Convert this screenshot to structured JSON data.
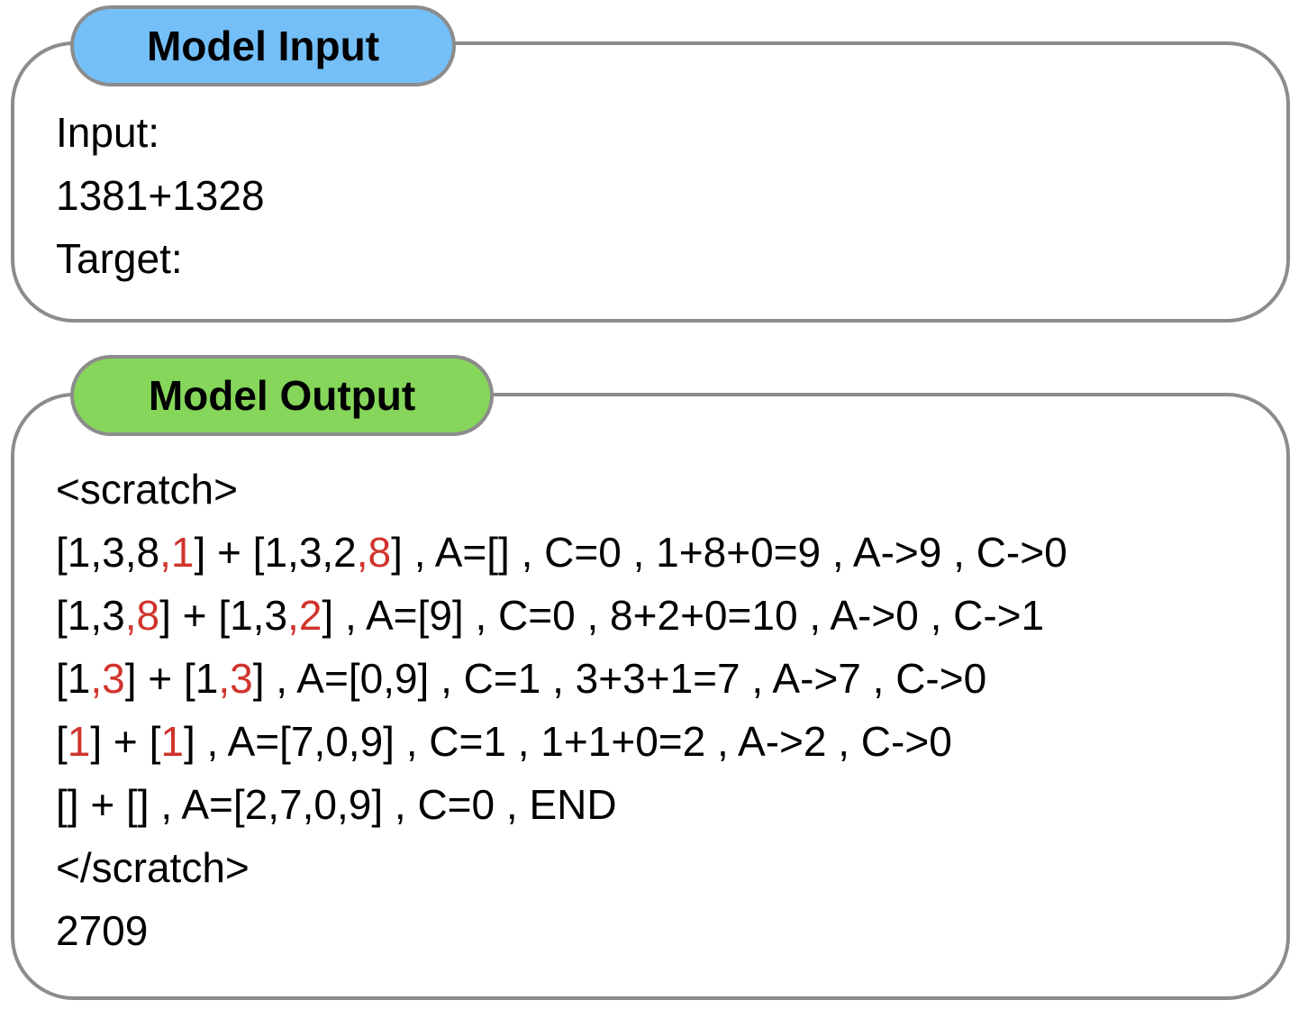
{
  "input_panel": {
    "title": "Model Input",
    "title_color": "#74bff8",
    "lines": [
      "Input:",
      "1381+1328",
      "Target:"
    ]
  },
  "output_panel": {
    "title": "Model Output",
    "title_color": "#85d65a",
    "highlight_color": "#d0342c",
    "lines": [
      [
        {
          "t": "<scratch>"
        }
      ],
      [
        {
          "t": "[1,3,8"
        },
        {
          "t": ",1",
          "hl": true
        },
        {
          "t": "] + [1,3,2"
        },
        {
          "t": ",8",
          "hl": true
        },
        {
          "t": "] , A=[] , C=0 , 1+8+0=9 , A->9 , C->0"
        }
      ],
      [
        {
          "t": "[1,3"
        },
        {
          "t": ",8",
          "hl": true
        },
        {
          "t": "] + [1,3"
        },
        {
          "t": ",2",
          "hl": true
        },
        {
          "t": "] , A=[9] , C=0 , 8+2+0=10 , A->0 , C->1"
        }
      ],
      [
        {
          "t": "[1"
        },
        {
          "t": ",3",
          "hl": true
        },
        {
          "t": "] + [1"
        },
        {
          "t": ",3",
          "hl": true
        },
        {
          "t": "] , A=[0,9] , C=1 , 3+3+1=7 , A->7 , C->0"
        }
      ],
      [
        {
          "t": "["
        },
        {
          "t": "1",
          "hl": true
        },
        {
          "t": "] + ["
        },
        {
          "t": "1",
          "hl": true
        },
        {
          "t": "] , A=[7,0,9] , C=1 , 1+1+0=2 , A->2 , C->0"
        }
      ],
      [
        {
          "t": "[] + [] , A=[2,7,0,9] , C=0 , END"
        }
      ],
      [
        {
          "t": "</scratch>"
        }
      ],
      [
        {
          "t": "2709"
        }
      ]
    ]
  }
}
